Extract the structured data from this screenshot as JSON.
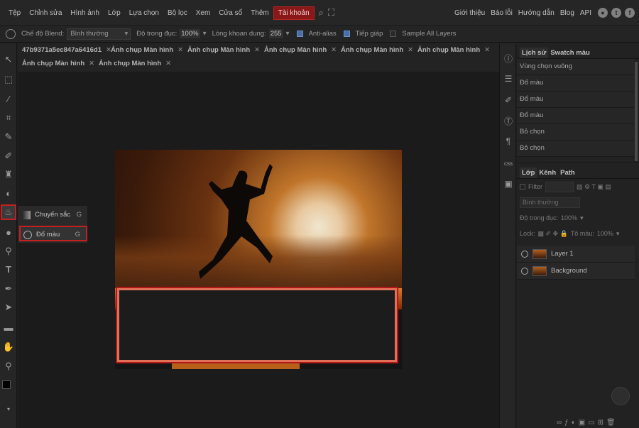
{
  "menubar": {
    "items": [
      "Tệp",
      "Chỉnh sửa",
      "Hình ảnh",
      "Lớp",
      "Lựa chọn",
      "Bộ lọc",
      "Xem",
      "Cửa sổ",
      "Thêm",
      "Tài khoản"
    ],
    "active_item": "Tài khoản",
    "right_links": [
      "Giới thiệu",
      "Báo lỗi",
      "Hướng dẫn",
      "Blog",
      "API"
    ]
  },
  "options": {
    "blend_label": "Chế độ Blend:",
    "blend_value": "Bình thường",
    "opacity_label": "Độ trong đục:",
    "opacity_value": "100%",
    "tolerance_label": "Lòng khoan dung:",
    "tolerance_value": "255",
    "antialias_label": "Anti-alias",
    "contiguous_label": "Tiếp giáp",
    "sample_label": "Sample All Layers"
  },
  "tabs": {
    "row1": [
      "47b9371a5ec847a6416d1",
      "Ảnh chụp Màn hình",
      "Ảnh chụp Màn hình",
      "Ảnh chụp Màn hình",
      "Ảnh chụp Màn hình",
      "Ảnh chụp Màn hình"
    ],
    "row2": [
      "Ảnh chụp Màn hình",
      "Ảnh chụp Màn hình"
    ]
  },
  "flyout": {
    "item1_label": "Chuyển sắc",
    "item1_key": "G",
    "item2_label": "Đổ màu",
    "item2_key": "G"
  },
  "history": {
    "tab1": "Lịch sử",
    "tab2": "Swatch màu",
    "rows": [
      "Vùng chọn vuông",
      "Đổ màu",
      "Đổ màu",
      "Đổ màu",
      "Bỏ chọn",
      "Bỏ chọn"
    ]
  },
  "layers": {
    "tab1": "Lớp",
    "tab2": "Kênh",
    "tab3": "Path",
    "filter_label": "Filter",
    "blend_value": "Bình thường",
    "opacity_label": "Độ trong đục:",
    "opacity_value": "100%",
    "lock_label": "Lock:",
    "fill_label": "Tô màu:",
    "fill_value": "100%",
    "items": [
      "Layer 1",
      "Background"
    ]
  },
  "colors": {
    "accent_red": "#c42020",
    "foreground": "#000000",
    "background": "#ffffff"
  }
}
